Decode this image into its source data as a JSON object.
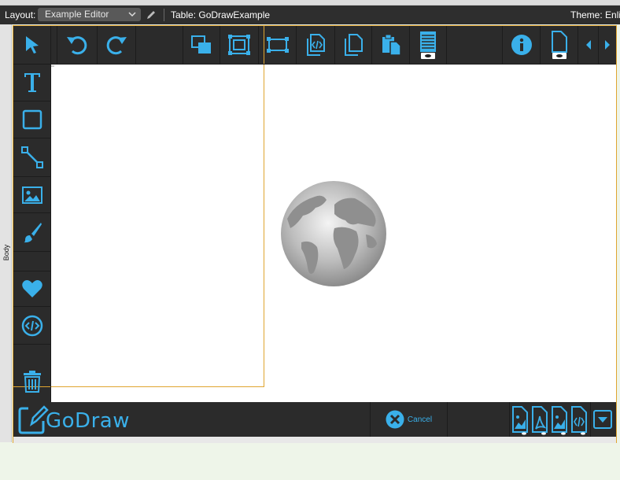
{
  "layout_bar": {
    "layout_label": "Layout:",
    "layout_value": "Example Editor",
    "table_label": "Table: GoDrawExample",
    "theme_label": "Theme: Enlig"
  },
  "body_part_label": "Body",
  "canvas": {
    "mark": "””"
  },
  "logo": {
    "text": "GoDraw"
  },
  "cancel": {
    "label": "Cancel"
  },
  "colors": {
    "accent": "#3ab0ea",
    "frame_border": "#e0a530",
    "toolbar_bg": "#2b2b2b",
    "bar_bg": "#2e2e2e"
  },
  "icons": {
    "left_toolbar": [
      "pointer-icon",
      "text-icon",
      "rectangle-icon",
      "line-icon",
      "image-icon",
      "brush-icon",
      "heart-icon",
      "code-icon",
      "trash-icon"
    ],
    "top_toolbar": [
      "undo-icon",
      "redo-icon",
      "bring-to-front-icon",
      "group-icon",
      "ungroup-icon",
      "source-icon",
      "duplicate-icon",
      "paste-icon",
      "list-preview-icon",
      "info-icon",
      "page-preview-icon",
      "chevron-left-icon",
      "chevron-right-icon"
    ],
    "bottom_toolbar": [
      "export-image-icon",
      "export-pdf-icon",
      "export-image-alt-icon",
      "export-code-icon",
      "dropdown-icon"
    ]
  }
}
